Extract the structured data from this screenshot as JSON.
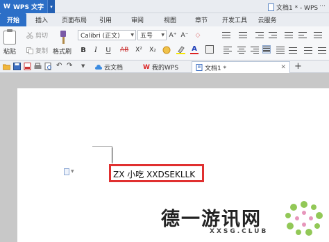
{
  "app": {
    "name": "WPS 文字",
    "logo_text": "W",
    "accent_color": "#2c6fc7",
    "window_doc_title": "文档1 * - WPS"
  },
  "ribbon_tabs": [
    "开始",
    "插入",
    "页面布局",
    "引用",
    "审阅",
    "视图",
    "章节",
    "开发工具",
    "云服务"
  ],
  "ribbon": {
    "paste_label": "粘贴",
    "cut_label": "剪切",
    "copy_label": "复制",
    "format_painter_label": "格式刷",
    "font_name": "Calibri (正文)",
    "font_size": "五号",
    "bold": "B",
    "italic": "I",
    "underline": "U",
    "strikethrough": "AB",
    "superscript": "X²",
    "subscript": "X₂",
    "font_color_letter": "A",
    "font_grow": "A⁺",
    "font_shrink": "A⁻",
    "clear_format": "◇"
  },
  "doc_tabs": {
    "cloud_docs": "云文档",
    "my_wps": "我的WPS",
    "doc1": "文档1 *",
    "new_tab": "+"
  },
  "document": {
    "text": "ZX 小吃 XXDSEKLLK"
  },
  "watermark": {
    "title": "德一游讯网",
    "url": "XXSG.CLUB"
  }
}
